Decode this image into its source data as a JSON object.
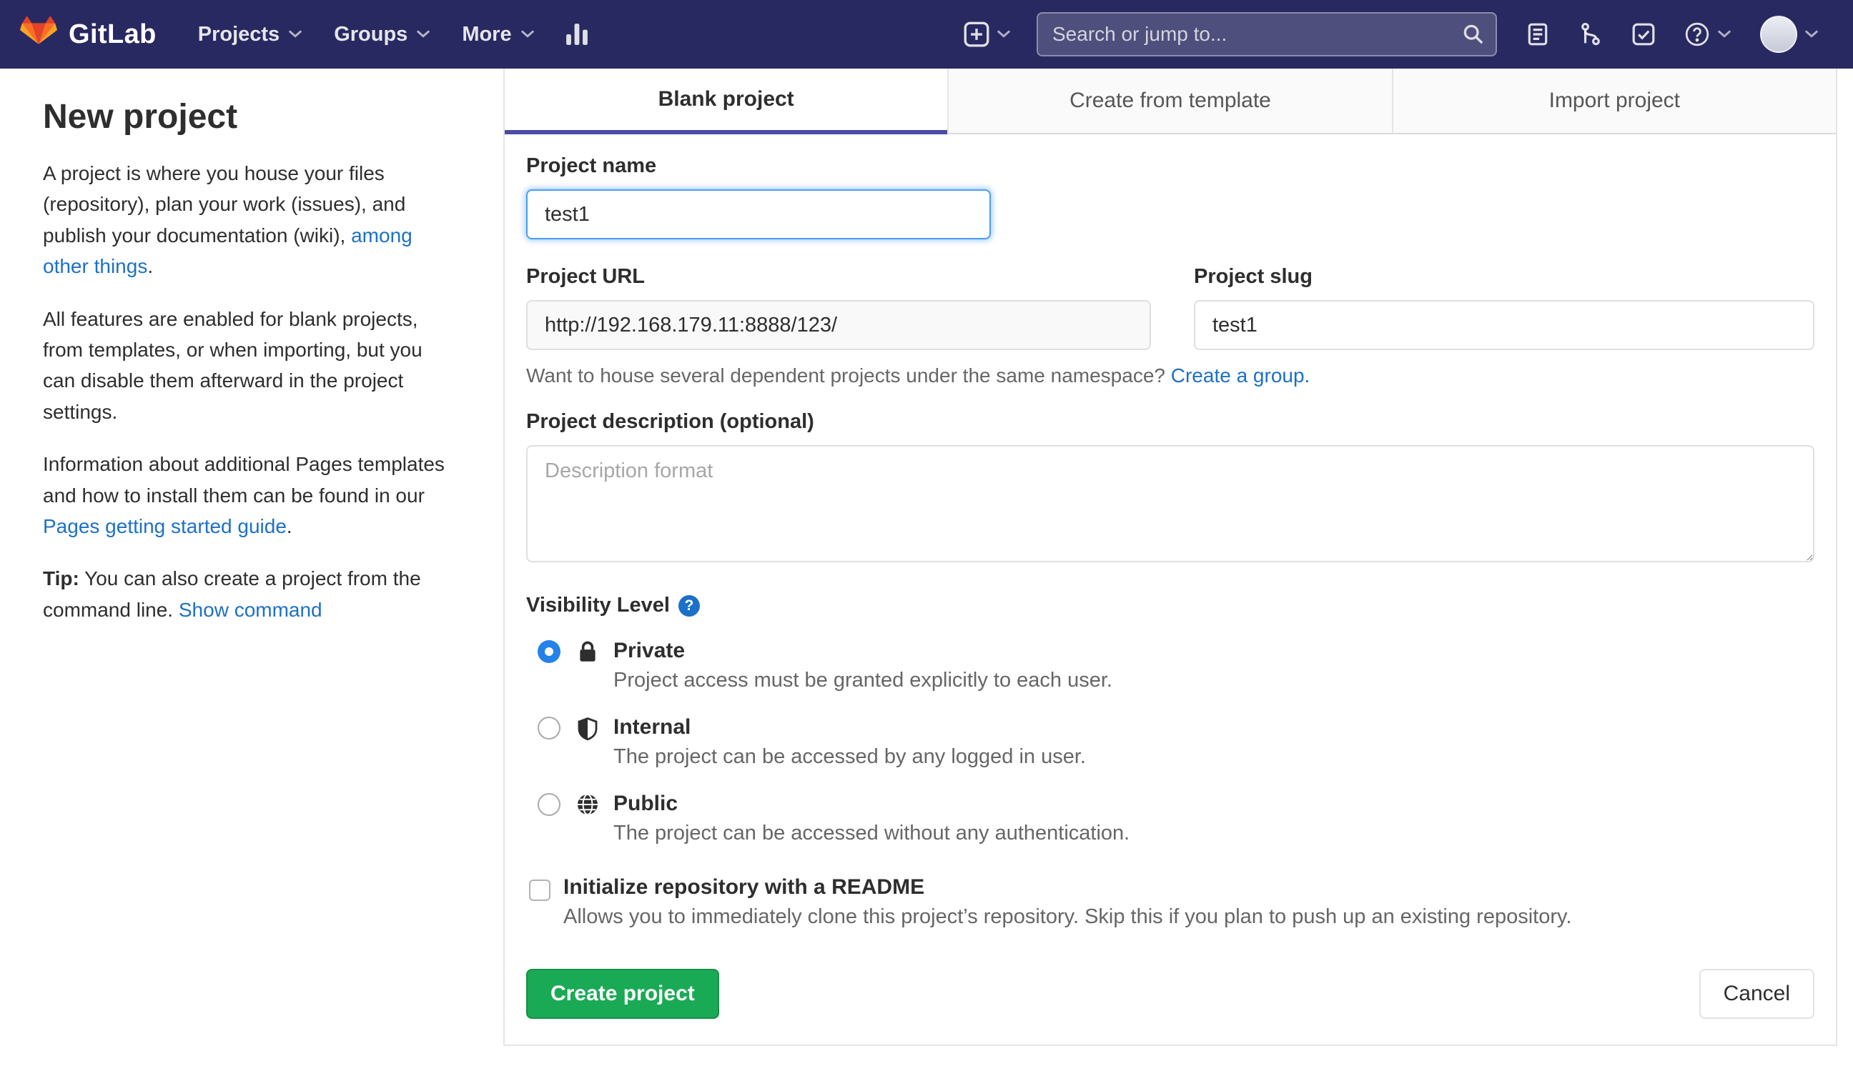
{
  "navbar": {
    "brand": "GitLab",
    "items": [
      {
        "label": "Projects"
      },
      {
        "label": "Groups"
      },
      {
        "label": "More"
      }
    ],
    "search_placeholder": "Search or jump to..."
  },
  "sidebar": {
    "title": "New project",
    "intro": {
      "text": "A project is where you house your files (repository), plan your work (issues), and publish your documentation (wiki), ",
      "link": "among other things",
      "suffix": "."
    },
    "features": "All features are enabled for blank projects, from templates, or when importing, but you can disable them afterward in the project settings.",
    "pages": {
      "text": "Information about additional Pages templates and how to install them can be found in our ",
      "link": "Pages getting started guide",
      "suffix": "."
    },
    "tip": {
      "bold": "Tip:",
      "text": " You can also create a project from the command line. ",
      "link": "Show command"
    }
  },
  "tabs": [
    {
      "label": "Blank project",
      "active": true
    },
    {
      "label": "Create from template",
      "active": false
    },
    {
      "label": "Import project",
      "active": false
    }
  ],
  "form": {
    "name": {
      "label": "Project name",
      "value": "test1"
    },
    "url": {
      "label": "Project URL",
      "value": "http://192.168.179.11:8888/123/"
    },
    "slug": {
      "label": "Project slug",
      "value": "test1"
    },
    "namespace_hint": {
      "text": "Want to house several dependent projects under the same namespace? ",
      "link": "Create a group."
    },
    "description": {
      "label": "Project description (optional)",
      "placeholder": "Description format"
    },
    "visibility": {
      "label": "Visibility Level",
      "help_glyph": "?",
      "options": [
        {
          "name": "Private",
          "desc": "Project access must be granted explicitly to each user.",
          "icon": "lock",
          "selected": true
        },
        {
          "name": "Internal",
          "desc": "The project can be accessed by any logged in user.",
          "icon": "shield-half",
          "selected": false
        },
        {
          "name": "Public",
          "desc": "The project can be accessed without any authentication.",
          "icon": "globe",
          "selected": false
        }
      ]
    },
    "readme": {
      "label": "Initialize repository with a README",
      "desc": "Allows you to immediately clone this project’s repository. Skip this if you plan to push up an existing repository.",
      "checked": false
    },
    "buttons": {
      "create": "Create project",
      "cancel": "Cancel"
    }
  },
  "icons": {
    "brand": "gitlab-tanuki",
    "nav_caret": "chevron-down",
    "analytics": "bar-chart",
    "new_menu": "plus-square",
    "search": "magnifier",
    "issues": "document-lines",
    "merge_requests": "git-merge",
    "todos": "check-square",
    "help": "question-circle",
    "user": "avatar-circle",
    "visibility_help": "question-circle",
    "private": "lock",
    "internal": "shield-half",
    "public": "globe"
  },
  "colors": {
    "navbar_bg": "#292961",
    "link": "#1d70c7",
    "primary_button": "#1aaa55",
    "active_tab_indicator": "#4b4ba3",
    "focus_ring": "#4b9ef0"
  }
}
